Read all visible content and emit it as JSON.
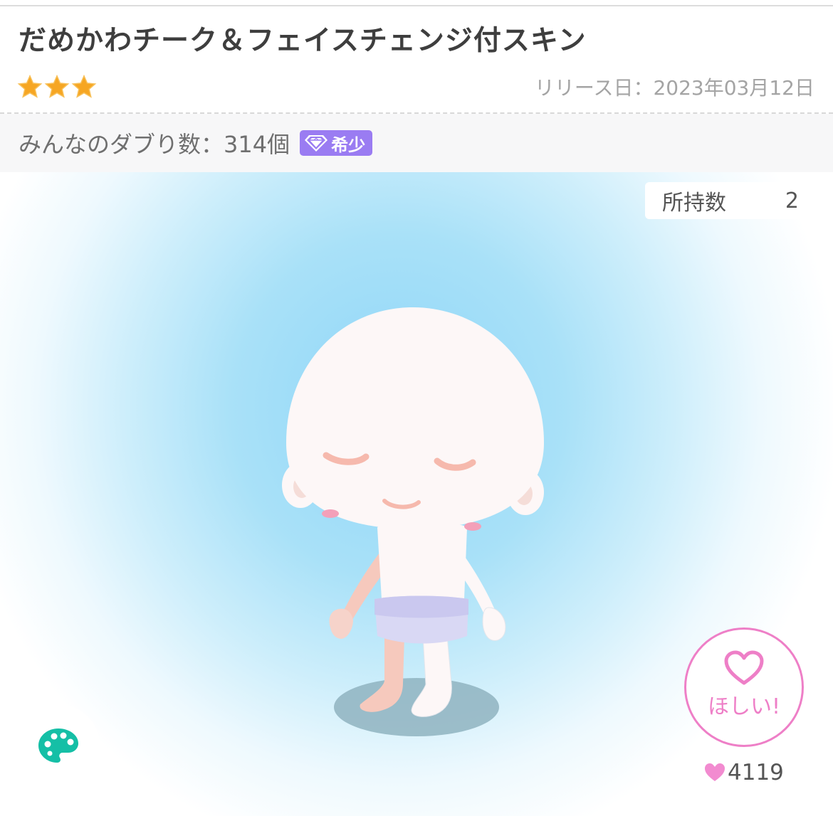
{
  "item": {
    "title": "だめかわチーク＆フェイスチェンジ付スキン",
    "star_rating": 3,
    "release_label": "リリース日：2023年03月12日"
  },
  "duplicates": {
    "label": "みんなのダブり数：314個",
    "rarity_badge": "希少",
    "badge_icon": "diamond-icon"
  },
  "ownership": {
    "label": "所持数",
    "count": "2"
  },
  "actions": {
    "palette_icon": "palette-icon",
    "want_label": "ほしい!",
    "want_icon": "heart-outline-icon",
    "like_count": "4119"
  },
  "colors": {
    "accent_pink": "#ee7fc7",
    "badge_purple": "#9a7cf2",
    "palette_teal": "#15bfa6",
    "star_gold": "#f6a623",
    "background_blue": "#8fd6f7"
  }
}
